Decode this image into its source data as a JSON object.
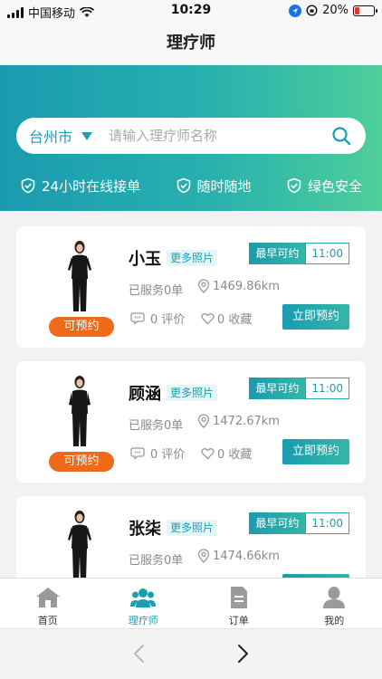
{
  "status_bar": {
    "carrier": "中国移动",
    "time": "10:29",
    "battery": "20%",
    "battery_level": 0.2
  },
  "nav": {
    "title": "理疗师"
  },
  "search": {
    "city": "台州市",
    "placeholder": "请输入理疗师名称"
  },
  "features": [
    {
      "label": "24小时在线接单",
      "icon": "shield-check-icon"
    },
    {
      "label": "随时随地",
      "icon": "shield-check-icon"
    },
    {
      "label": "绿色安全",
      "icon": "shield-check-icon"
    }
  ],
  "therapists": [
    {
      "name": "小玉",
      "more_photos": "更多照片",
      "earliest_label": "最早可约",
      "earliest_time": "11:00",
      "served": "已服务0单",
      "distance": "1469.86km",
      "reviews": "0 评价",
      "favorites": "0 收藏",
      "book_label": "立即预约",
      "status_badge": "可预约"
    },
    {
      "name": "顾涵",
      "more_photos": "更多照片",
      "earliest_label": "最早可约",
      "earliest_time": "11:00",
      "served": "已服务0单",
      "distance": "1472.67km",
      "reviews": "0 评价",
      "favorites": "0 收藏",
      "book_label": "立即预约",
      "status_badge": "可预约"
    },
    {
      "name": "张柒",
      "more_photos": "更多照片",
      "earliest_label": "最早可约",
      "earliest_time": "11:00",
      "served": "已服务0单",
      "distance": "1474.66km",
      "reviews": "",
      "favorites": "",
      "book_label": "",
      "status_badge": ""
    }
  ],
  "tabs": [
    {
      "label": "首页",
      "icon": "home-icon",
      "active": false
    },
    {
      "label": "理疗师",
      "icon": "therapists-icon",
      "active": true
    },
    {
      "label": "订单",
      "icon": "order-icon",
      "active": false
    },
    {
      "label": "我的",
      "icon": "profile-icon",
      "active": false
    }
  ],
  "colors": {
    "accent": "#1a9fb0",
    "gradient_start": "#1a9bb0",
    "gradient_end": "#4ecf9a",
    "badge_orange": "#ee6a1a"
  }
}
